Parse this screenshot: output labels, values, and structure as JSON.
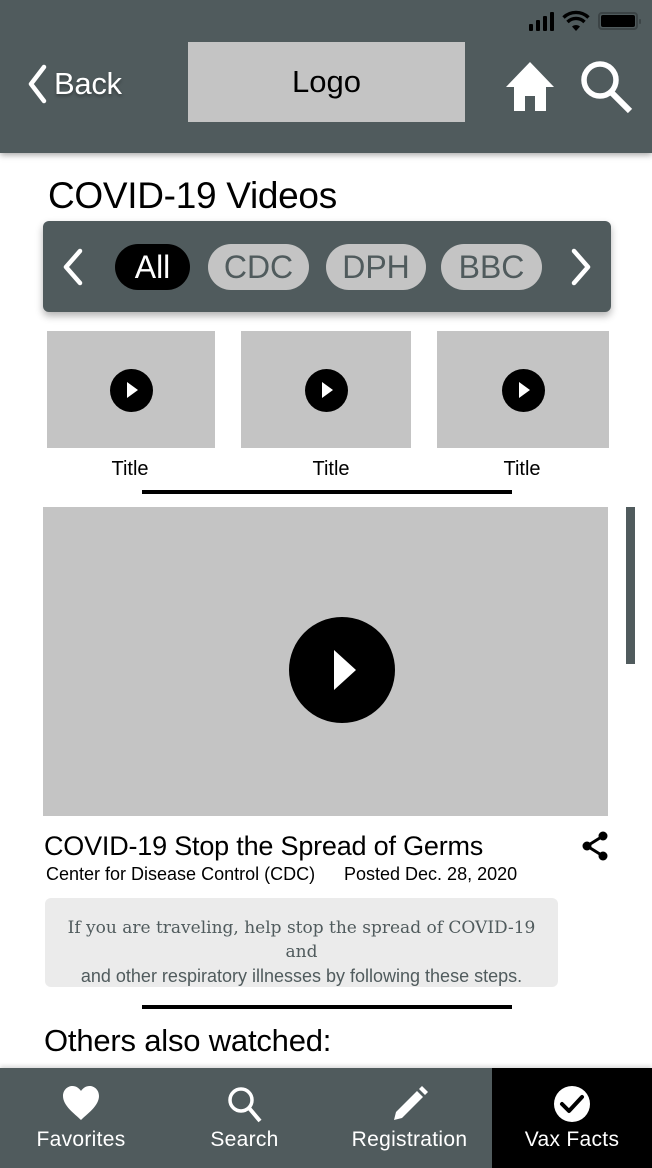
{
  "status_bar": {
    "icons": [
      "cellular-signal-icon",
      "wifi-icon",
      "battery-icon"
    ]
  },
  "header": {
    "back_label": "Back",
    "logo_text": "Logo",
    "icons": [
      "home-icon",
      "search-icon"
    ]
  },
  "page": {
    "title": "COVID-19 Videos"
  },
  "filters": {
    "items": [
      {
        "label": "All",
        "active": true
      },
      {
        "label": "CDC",
        "active": false
      },
      {
        "label": "DPH",
        "active": false
      },
      {
        "label": "BBC",
        "active": false
      }
    ]
  },
  "thumbnails": [
    {
      "title": "Title"
    },
    {
      "title": "Title"
    },
    {
      "title": "Title"
    }
  ],
  "video": {
    "title": "COVID-19 Stop the Spread of Germs",
    "source": "Center for Disease Control (CDC)",
    "posted": "Posted Dec. 28, 2020",
    "description_line1": "If you are traveling, help stop the spread of COVID-19 and",
    "description_line2": "and other respiratory illnesses by following these steps."
  },
  "others": {
    "heading": "Others also watched:"
  },
  "bottom_nav": {
    "items": [
      {
        "label": "Favorites",
        "icon": "heart-icon",
        "active": false
      },
      {
        "label": "Search",
        "icon": "search-icon",
        "active": false
      },
      {
        "label": "Registration",
        "icon": "pencil-icon",
        "active": false
      },
      {
        "label": "Vax Facts",
        "icon": "check-circle-icon",
        "active": true
      }
    ]
  },
  "colors": {
    "header_bg": "#505B5D",
    "placeholder_gray": "#C4C4C4",
    "active_chip": "#000000",
    "description_bg": "#EBEBEB"
  }
}
